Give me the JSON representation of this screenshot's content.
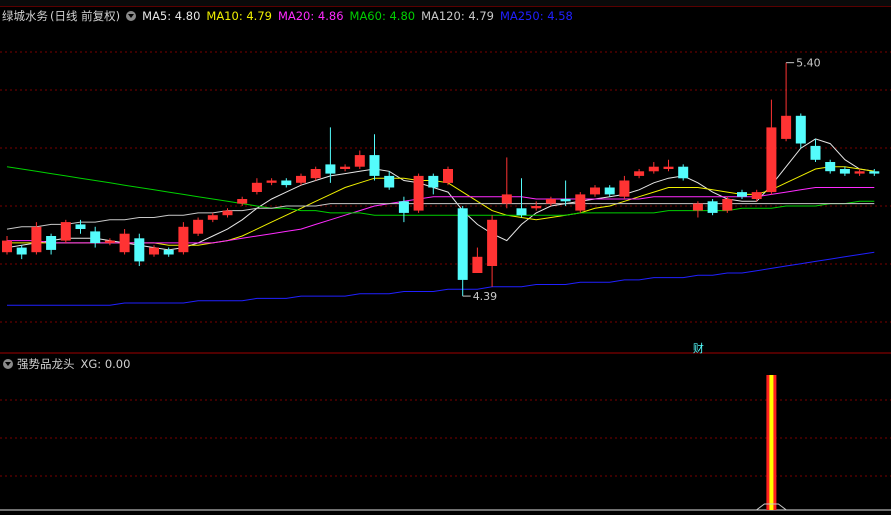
{
  "window": {
    "stock_name": "绿城水务",
    "period": "(日线 前复权)"
  },
  "ma_legend": [
    {
      "label": "MA5: 4.80",
      "color": "#e6e6e6"
    },
    {
      "label": "MA10: 4.79",
      "color": "#f0f000"
    },
    {
      "label": "MA20: 4.86",
      "color": "#ff2bff"
    },
    {
      "label": "MA60: 4.80",
      "color": "#00d000"
    },
    {
      "label": "MA120: 4.79",
      "color": "#c8c8c8"
    },
    {
      "label": "MA250: 4.58",
      "color": "#2020ff"
    }
  ],
  "price_annotations": {
    "high": "5.40",
    "low": "4.39",
    "finance_marker": "财"
  },
  "sub_panel": {
    "title": "强势品龙头",
    "xg_label": "XG: 0.00"
  },
  "colors": {
    "up": "#ff3333",
    "down": "#54fcfc",
    "grid": "#7a0000",
    "axis": "#a00000",
    "signal_outer": "#ff2020",
    "signal_inner": "#ffff00"
  },
  "chart_data": {
    "type": "candlestick",
    "high_label": 5.4,
    "low_label": 4.39,
    "candles": [
      {
        "o": 4.58,
        "c": 4.63,
        "h": 4.65,
        "l": 4.57,
        "dir": "up"
      },
      {
        "o": 4.6,
        "c": 4.57,
        "h": 4.61,
        "l": 4.55,
        "dir": "down"
      },
      {
        "o": 4.58,
        "c": 4.69,
        "h": 4.71,
        "l": 4.57,
        "dir": "up"
      },
      {
        "o": 4.65,
        "c": 4.59,
        "h": 4.66,
        "l": 4.57,
        "dir": "down"
      },
      {
        "o": 4.63,
        "c": 4.71,
        "h": 4.72,
        "l": 4.62,
        "dir": "up"
      },
      {
        "o": 4.7,
        "c": 4.68,
        "h": 4.72,
        "l": 4.66,
        "dir": "down"
      },
      {
        "o": 4.67,
        "c": 4.62,
        "h": 4.69,
        "l": 4.6,
        "dir": "down"
      },
      {
        "o": 4.62,
        "c": 4.63,
        "h": 4.64,
        "l": 4.61,
        "dir": "up"
      },
      {
        "o": 4.58,
        "c": 4.66,
        "h": 4.68,
        "l": 4.57,
        "dir": "up"
      },
      {
        "o": 4.64,
        "c": 4.54,
        "h": 4.66,
        "l": 4.52,
        "dir": "down"
      },
      {
        "o": 4.57,
        "c": 4.6,
        "h": 4.61,
        "l": 4.56,
        "dir": "up"
      },
      {
        "o": 4.59,
        "c": 4.57,
        "h": 4.6,
        "l": 4.56,
        "dir": "down"
      },
      {
        "o": 4.58,
        "c": 4.69,
        "h": 4.71,
        "l": 4.57,
        "dir": "up"
      },
      {
        "o": 4.66,
        "c": 4.72,
        "h": 4.73,
        "l": 4.65,
        "dir": "up"
      },
      {
        "o": 4.72,
        "c": 4.74,
        "h": 4.75,
        "l": 4.71,
        "dir": "up"
      },
      {
        "o": 4.74,
        "c": 4.76,
        "h": 4.77,
        "l": 4.73,
        "dir": "up"
      },
      {
        "o": 4.79,
        "c": 4.81,
        "h": 4.82,
        "l": 4.78,
        "dir": "up"
      },
      {
        "o": 4.84,
        "c": 4.88,
        "h": 4.9,
        "l": 4.83,
        "dir": "up"
      },
      {
        "o": 4.88,
        "c": 4.89,
        "h": 4.9,
        "l": 4.87,
        "dir": "up"
      },
      {
        "o": 4.89,
        "c": 4.87,
        "h": 4.9,
        "l": 4.86,
        "dir": "down"
      },
      {
        "o": 4.88,
        "c": 4.91,
        "h": 4.92,
        "l": 4.87,
        "dir": "up"
      },
      {
        "o": 4.9,
        "c": 4.94,
        "h": 4.95,
        "l": 4.89,
        "dir": "up"
      },
      {
        "o": 4.96,
        "c": 4.92,
        "h": 5.12,
        "l": 4.88,
        "dir": "down"
      },
      {
        "o": 4.94,
        "c": 4.95,
        "h": 4.96,
        "l": 4.93,
        "dir": "up"
      },
      {
        "o": 4.95,
        "c": 5.0,
        "h": 5.02,
        "l": 4.94,
        "dir": "up"
      },
      {
        "o": 5.0,
        "c": 4.91,
        "h": 5.09,
        "l": 4.89,
        "dir": "down"
      },
      {
        "o": 4.91,
        "c": 4.86,
        "h": 4.93,
        "l": 4.85,
        "dir": "down"
      },
      {
        "o": 4.8,
        "c": 4.75,
        "h": 4.82,
        "l": 4.71,
        "dir": "down"
      },
      {
        "o": 4.76,
        "c": 4.91,
        "h": 4.92,
        "l": 4.75,
        "dir": "up"
      },
      {
        "o": 4.91,
        "c": 4.86,
        "h": 4.92,
        "l": 4.83,
        "dir": "down"
      },
      {
        "o": 4.88,
        "c": 4.94,
        "h": 4.95,
        "l": 4.87,
        "dir": "up"
      },
      {
        "o": 4.77,
        "c": 4.46,
        "h": 4.78,
        "l": 4.39,
        "dir": "down"
      },
      {
        "o": 4.49,
        "c": 4.56,
        "h": 4.6,
        "l": 4.49,
        "dir": "up"
      },
      {
        "o": 4.52,
        "c": 4.72,
        "h": 4.74,
        "l": 4.43,
        "dir": "up"
      },
      {
        "o": 4.79,
        "c": 4.83,
        "h": 4.99,
        "l": 4.77,
        "dir": "up"
      },
      {
        "o": 4.77,
        "c": 4.74,
        "h": 4.9,
        "l": 4.73,
        "dir": "down"
      },
      {
        "o": 4.77,
        "c": 4.78,
        "h": 4.8,
        "l": 4.76,
        "dir": "up"
      },
      {
        "o": 4.79,
        "c": 4.81,
        "h": 4.82,
        "l": 4.78,
        "dir": "up"
      },
      {
        "o": 4.81,
        "c": 4.8,
        "h": 4.89,
        "l": 4.78,
        "dir": "down"
      },
      {
        "o": 4.76,
        "c": 4.83,
        "h": 4.84,
        "l": 4.75,
        "dir": "up"
      },
      {
        "o": 4.83,
        "c": 4.86,
        "h": 4.87,
        "l": 4.82,
        "dir": "up"
      },
      {
        "o": 4.86,
        "c": 4.83,
        "h": 4.87,
        "l": 4.82,
        "dir": "down"
      },
      {
        "o": 4.82,
        "c": 4.89,
        "h": 4.91,
        "l": 4.81,
        "dir": "up"
      },
      {
        "o": 4.91,
        "c": 4.93,
        "h": 4.94,
        "l": 4.9,
        "dir": "up"
      },
      {
        "o": 4.93,
        "c": 4.95,
        "h": 4.97,
        "l": 4.92,
        "dir": "up"
      },
      {
        "o": 4.95,
        "c": 4.94,
        "h": 4.98,
        "l": 4.93,
        "dir": "up"
      },
      {
        "o": 4.95,
        "c": 4.9,
        "h": 4.96,
        "l": 4.89,
        "dir": "down"
      },
      {
        "o": 4.76,
        "c": 4.79,
        "h": 4.8,
        "l": 4.73,
        "dir": "up"
      },
      {
        "o": 4.8,
        "c": 4.75,
        "h": 4.81,
        "l": 4.74,
        "dir": "down"
      },
      {
        "o": 4.76,
        "c": 4.81,
        "h": 4.82,
        "l": 4.75,
        "dir": "up"
      },
      {
        "o": 4.84,
        "c": 4.82,
        "h": 4.85,
        "l": 4.81,
        "dir": "down"
      },
      {
        "o": 4.81,
        "c": 4.84,
        "h": 4.85,
        "l": 4.8,
        "dir": "up"
      },
      {
        "o": 4.84,
        "c": 5.12,
        "h": 5.24,
        "l": 4.83,
        "dir": "up"
      },
      {
        "o": 5.07,
        "c": 5.17,
        "h": 5.4,
        "l": 5.06,
        "dir": "up"
      },
      {
        "o": 5.17,
        "c": 5.05,
        "h": 5.18,
        "l": 5.03,
        "dir": "down"
      },
      {
        "o": 5.04,
        "c": 4.98,
        "h": 5.07,
        "l": 4.97,
        "dir": "down"
      },
      {
        "o": 4.97,
        "c": 4.93,
        "h": 4.98,
        "l": 4.92,
        "dir": "down"
      },
      {
        "o": 4.94,
        "c": 4.92,
        "h": 4.95,
        "l": 4.91,
        "dir": "down"
      },
      {
        "o": 4.92,
        "c": 4.93,
        "h": 4.94,
        "l": 4.91,
        "dir": "up"
      },
      {
        "o": 4.93,
        "c": 4.92,
        "h": 4.94,
        "l": 4.91,
        "dir": "down"
      }
    ],
    "moving_averages": [
      {
        "name": "MA5",
        "color": "#e6e6e6",
        "values": [
          4.6,
          4.61,
          4.62,
          4.63,
          4.64,
          4.64,
          4.64,
          4.63,
          4.62,
          4.61,
          4.6,
          4.59,
          4.6,
          4.62,
          4.65,
          4.68,
          4.72,
          4.77,
          4.81,
          4.84,
          4.87,
          4.89,
          4.91,
          4.92,
          4.93,
          4.94,
          4.93,
          4.89,
          4.88,
          4.86,
          4.84,
          4.76,
          4.7,
          4.66,
          4.63,
          4.7,
          4.75,
          4.78,
          4.79,
          4.8,
          4.81,
          4.82,
          4.83,
          4.85,
          4.88,
          4.9,
          4.91,
          4.88,
          4.84,
          4.81,
          4.8,
          4.8,
          4.87,
          4.95,
          5.03,
          5.07,
          5.05,
          4.98,
          4.94,
          4.93
        ]
      },
      {
        "name": "MA10",
        "color": "#f0f000",
        "values": [
          4.62,
          4.62,
          4.62,
          4.62,
          4.62,
          4.62,
          4.62,
          4.62,
          4.62,
          4.62,
          4.62,
          4.61,
          4.61,
          4.61,
          4.62,
          4.63,
          4.65,
          4.68,
          4.71,
          4.74,
          4.77,
          4.8,
          4.83,
          4.86,
          4.88,
          4.9,
          4.9,
          4.9,
          4.89,
          4.89,
          4.88,
          4.84,
          4.8,
          4.76,
          4.74,
          4.73,
          4.72,
          4.73,
          4.74,
          4.75,
          4.77,
          4.78,
          4.8,
          4.82,
          4.84,
          4.86,
          4.86,
          4.86,
          4.85,
          4.84,
          4.83,
          4.83,
          4.85,
          4.88,
          4.91,
          4.94,
          4.95,
          4.95,
          4.94,
          4.93
        ]
      },
      {
        "name": "MA20",
        "color": "#ff2bff",
        "values": [
          4.63,
          4.63,
          4.63,
          4.62,
          4.62,
          4.62,
          4.62,
          4.62,
          4.62,
          4.62,
          4.62,
          4.62,
          4.62,
          4.62,
          4.62,
          4.63,
          4.64,
          4.65,
          4.66,
          4.67,
          4.68,
          4.7,
          4.72,
          4.74,
          4.76,
          4.78,
          4.79,
          4.8,
          4.81,
          4.82,
          4.82,
          4.82,
          4.82,
          4.82,
          4.82,
          4.82,
          4.81,
          4.81,
          4.81,
          4.81,
          4.81,
          4.81,
          4.81,
          4.81,
          4.82,
          4.82,
          4.82,
          4.82,
          4.82,
          4.82,
          4.82,
          4.82,
          4.83,
          4.84,
          4.85,
          4.86,
          4.86,
          4.86,
          4.86,
          4.86
        ]
      },
      {
        "name": "MA60",
        "color": "#00d000",
        "values": [
          4.95,
          4.94,
          4.93,
          4.92,
          4.91,
          4.9,
          4.89,
          4.88,
          4.87,
          4.86,
          4.85,
          4.84,
          4.83,
          4.82,
          4.81,
          4.8,
          4.79,
          4.78,
          4.77,
          4.77,
          4.76,
          4.76,
          4.75,
          4.75,
          4.75,
          4.74,
          4.74,
          4.74,
          4.74,
          4.74,
          4.74,
          4.74,
          4.74,
          4.74,
          4.74,
          4.74,
          4.74,
          4.74,
          4.74,
          4.75,
          4.75,
          4.75,
          4.75,
          4.75,
          4.75,
          4.76,
          4.76,
          4.76,
          4.76,
          4.76,
          4.77,
          4.77,
          4.77,
          4.78,
          4.78,
          4.78,
          4.79,
          4.79,
          4.8,
          4.8
        ]
      },
      {
        "name": "MA120",
        "color": "#c8c8c8",
        "values": [
          4.68,
          4.69,
          4.69,
          4.7,
          4.7,
          4.71,
          4.71,
          4.72,
          4.72,
          4.73,
          4.73,
          4.74,
          4.74,
          4.75,
          4.75,
          4.76,
          4.76,
          4.77,
          4.77,
          4.78,
          4.78,
          4.78,
          4.79,
          4.79,
          4.79,
          4.79,
          4.79,
          4.79,
          4.79,
          4.79,
          4.79,
          4.79,
          4.79,
          4.79,
          4.79,
          4.79,
          4.79,
          4.79,
          4.79,
          4.79,
          4.79,
          4.79,
          4.79,
          4.79,
          4.79,
          4.79,
          4.79,
          4.79,
          4.79,
          4.79,
          4.79,
          4.79,
          4.79,
          4.79,
          4.79,
          4.79,
          4.79,
          4.79,
          4.79,
          4.79
        ]
      },
      {
        "name": "MA250",
        "color": "#2020ff",
        "values": [
          4.35,
          4.35,
          4.35,
          4.35,
          4.35,
          4.35,
          4.35,
          4.35,
          4.36,
          4.36,
          4.36,
          4.36,
          4.36,
          4.37,
          4.37,
          4.37,
          4.37,
          4.38,
          4.38,
          4.38,
          4.39,
          4.39,
          4.39,
          4.39,
          4.4,
          4.4,
          4.4,
          4.41,
          4.41,
          4.41,
          4.42,
          4.42,
          4.42,
          4.43,
          4.43,
          4.43,
          4.44,
          4.44,
          4.44,
          4.45,
          4.45,
          4.45,
          4.46,
          4.46,
          4.47,
          4.47,
          4.47,
          4.48,
          4.48,
          4.49,
          4.49,
          4.5,
          4.51,
          4.52,
          4.53,
          4.54,
          4.55,
          4.56,
          4.57,
          4.58
        ]
      }
    ],
    "signal": {
      "name": "XG",
      "value": 0.0,
      "trigger_index": 52
    }
  }
}
